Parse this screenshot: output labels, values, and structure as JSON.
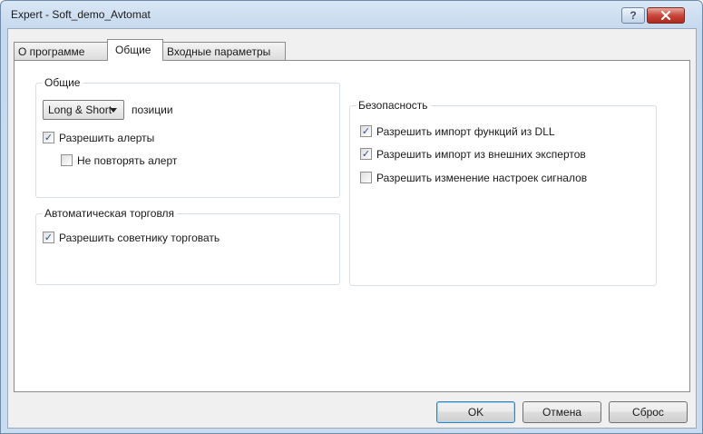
{
  "window": {
    "title": "Expert - Soft_demo_Avtomat",
    "help_glyph": "?",
    "close_glyph": "✕"
  },
  "tabs": [
    {
      "label": "О программе",
      "active": false
    },
    {
      "label": "Общие",
      "active": true
    },
    {
      "label": "Входные параметры",
      "active": false
    }
  ],
  "general": {
    "title": "Общие",
    "positions_select": {
      "value": "Long & Short"
    },
    "positions_label": "позиции",
    "allow_alerts": {
      "label": "Разрешить алерты",
      "checked": true
    },
    "no_repeat_alert": {
      "label": "Не повторять алерт",
      "checked": false
    }
  },
  "auto_trading": {
    "title": "Автоматическая торговля",
    "allow_ea_trade": {
      "label": "Разрешить советнику торговать",
      "checked": true
    }
  },
  "security": {
    "title": "Безопасность",
    "allow_dll": {
      "label": "Разрешить импорт функций из DLL",
      "checked": true
    },
    "allow_external": {
      "label": "Разрешить импорт из внешних экспертов",
      "checked": true
    },
    "allow_signal_settings": {
      "label": "Разрешить изменение настроек сигналов",
      "checked": false
    }
  },
  "buttons": {
    "ok": "OK",
    "cancel": "Отмена",
    "reset": "Сброс"
  },
  "check_glyph": "✓"
}
